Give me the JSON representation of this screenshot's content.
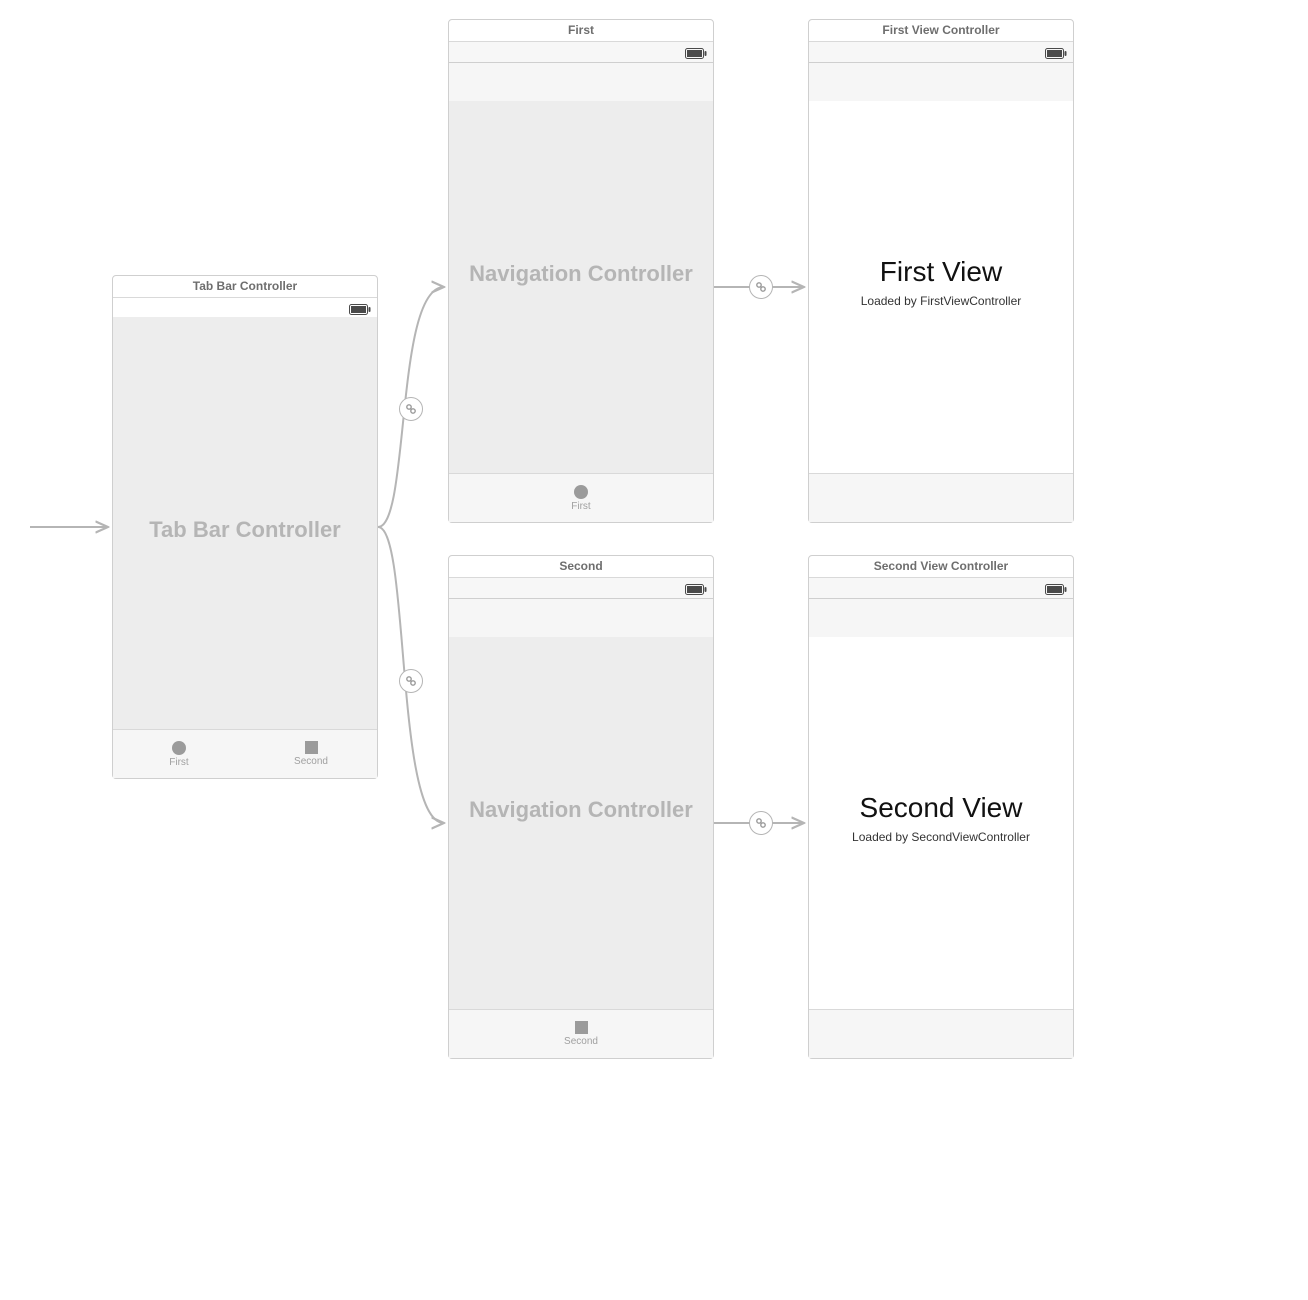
{
  "entry_arrow": true,
  "tab_bar_controller": {
    "title": "Tab Bar Controller",
    "center_label": "Tab Bar Controller",
    "tabs": [
      {
        "label": "First",
        "icon": "circle"
      },
      {
        "label": "Second",
        "icon": "square"
      }
    ]
  },
  "nav_first": {
    "title": "First",
    "center_label": "Navigation Controller",
    "tab": {
      "label": "First",
      "icon": "circle"
    }
  },
  "nav_second": {
    "title": "Second",
    "center_label": "Navigation Controller",
    "tab": {
      "label": "Second",
      "icon": "square"
    }
  },
  "vc_first": {
    "title": "First View Controller",
    "heading": "First View",
    "subheading": "Loaded by FirstViewController"
  },
  "vc_second": {
    "title": "Second View Controller",
    "heading": "Second View",
    "subheading": "Loaded by SecondViewController"
  }
}
